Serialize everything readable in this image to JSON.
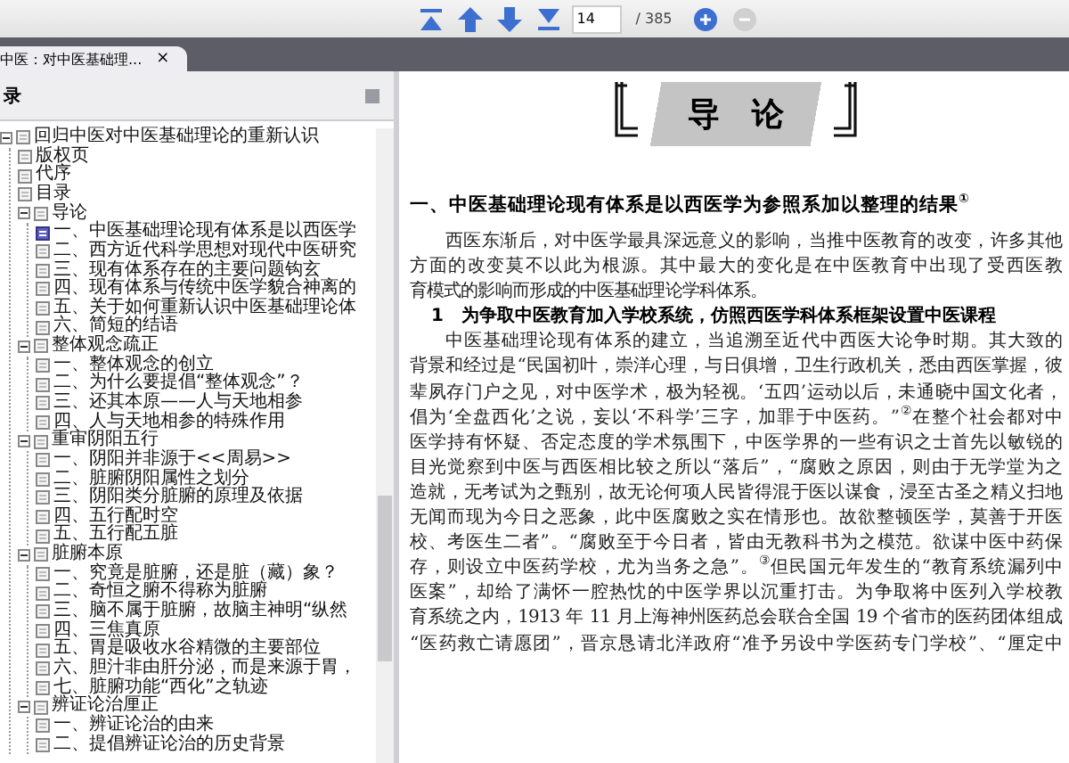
{
  "toolbar": {
    "page": "14",
    "page_total": "/ 385",
    "zoom_out_disabled": true
  },
  "tabs": [
    {
      "label": "中医：对中医基础理...",
      "close": "×",
      "selected": true
    }
  ],
  "sidebar": {
    "title": "录",
    "tree": [
      {
        "label": "回归中医对中医基础理论的重新认识",
        "expanded": true,
        "selected": false,
        "children": [
          {
            "label": "版权页",
            "selected": false
          },
          {
            "label": "代序",
            "selected": false
          },
          {
            "label": "目录",
            "selected": false
          },
          {
            "label": "导论",
            "expanded": true,
            "selected": false,
            "children": [
              {
                "label": "一、中医基础理论现有体系是以西医学",
                "selected": true
              },
              {
                "label": "二、西方近代科学思想对现代中医研究",
                "selected": false
              },
              {
                "label": "三、现有体系存在的主要问题钩玄",
                "selected": false
              },
              {
                "label": "四、现有体系与传统中医学貌合神离的",
                "selected": false
              },
              {
                "label": "五、关于如何重新认识中医基础理论体",
                "selected": false
              },
              {
                "label": "六、简短的结语",
                "selected": false
              }
            ]
          },
          {
            "label": "整体观念疏正",
            "expanded": true,
            "selected": false,
            "children": [
              {
                "label": "一、整体观念的创立",
                "selected": false
              },
              {
                "label": "二、为什么要提倡“整体观念”？",
                "selected": false
              },
              {
                "label": "三、还其本原——人与天地相参",
                "selected": false
              },
              {
                "label": "四、人与天地相参的特殊作用",
                "selected": false
              }
            ]
          },
          {
            "label": "重审阴阳五行",
            "expanded": true,
            "selected": false,
            "children": [
              {
                "label": "一、阴阳并非源于<<周易>>",
                "selected": false
              },
              {
                "label": "二、脏腑阴阳属性之划分",
                "selected": false
              },
              {
                "label": "三、阴阳类分脏腑的原理及依据",
                "selected": false
              },
              {
                "label": "四、五行配时空",
                "selected": false
              },
              {
                "label": "五、五行配五脏",
                "selected": false
              }
            ]
          },
          {
            "label": "脏腑本原",
            "expanded": true,
            "selected": false,
            "children": [
              {
                "label": "一、究竟是脏腑，还是脏（藏）象？",
                "selected": false
              },
              {
                "label": "二、奇恒之腑不得称为脏腑",
                "selected": false
              },
              {
                "label": "三、脑不属于脏腑，故脑主神明“纵然",
                "selected": false
              },
              {
                "label": "四、三焦真原",
                "selected": false
              },
              {
                "label": "五、胃是吸收水谷精微的主要部位",
                "selected": false
              },
              {
                "label": "六、胆汁非由肝分泌，而是来源于胃，",
                "selected": false
              },
              {
                "label": "七、脏腑功能“西化”之轨迹",
                "selected": false
              }
            ]
          },
          {
            "label": "辨证论治厘正",
            "expanded": true,
            "selected": false,
            "children": [
              {
                "label": "一、辨证论治的由来",
                "selected": false
              },
              {
                "label": "二、提倡辨证论治的历史背景",
                "selected": false
              }
            ]
          }
        ]
      }
    ]
  },
  "document": {
    "chapter_title": "导　论",
    "heading": "一、中医基础理论现有体系是以西医学为参照系加以整理的结果$^{①}$",
    "paragraphs": [
      {
        "kind": "body",
        "lines": [
          "西医东渐后，对中医学最具深远意义的影响，当推中医教育的改变，许多其他",
          "方面的改变莫不以此为根源。其中最大的变化是在中医教育中出现了受西医教",
          "育模式的影响而形成的中医基础理论学科体系。"
        ]
      },
      {
        "kind": "subheading",
        "lines": [
          "1　为争取中医教育加入学校系统，仿照西医学科体系框架设置中医课程"
        ]
      },
      {
        "kind": "body",
        "lines": [
          "中医基础理论现有体系的建立，当追溯至近代中西医大论争时期。其大致的",
          "背景和经过是“民国初叶，崇洋心理，与日俱增，卫生行政机关，悉由西医掌握，彼",
          "辈夙存门户之见，对中医学术，极为轻视。‘五四’运动以后，未通晓中国文化者，",
          "倡为‘全盘西化’之说，妄以‘不科学’三字，加罪于中医药。”$^{②}$在整个社会都对中",
          "医学持有怀疑、否定态度的学术氛围下，中医学界的一些有识之士首先以敏锐的",
          "目光觉察到中医与西医相比较之所以“落后”，“腐败之原因，则由于无学堂为之",
          "造就，无考试为之甄别，故无论何项人民皆得混于医以谋食，浸至古圣之精义扫地",
          "无闻而现为今日之恶象，此中医腐败之实在情形也。故欲整顿医学，莫善于开医",
          "校、考医生二者”。“腐败至于今日者，皆由无教科书为之模范。欲谋中医中药保",
          "存，则设立中医药学校，尤为当务之急”。$^{③}$但民国元年发生的“教育系统漏列中",
          "医案”，却给了满怀一腔热忱的中医学界以沉重打击。为争取将中医列入学校教",
          "育系统之内，1913 年 11 月上海神州医药总会联合全国 19 个省市的医药团体组成",
          "“医药救亡请愿团”，晋京恳请北洋政府“准予另设中学医药专门学校”、“厘定中"
        ]
      }
    ]
  }
}
